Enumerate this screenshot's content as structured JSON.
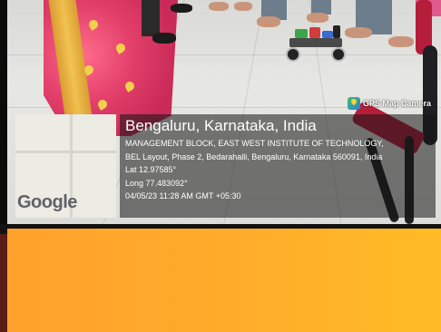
{
  "watermark": {
    "app_name": "GPS Map Camera",
    "map_provider": "Google",
    "location_title": "Bengaluru, Karnataka, India",
    "address_line1": "MANAGEMENT BLOCK, EAST WEST INSTITUTE OF TECHNOLOGY,",
    "address_line2": "BEL Layout, Phase 2, Bedarahalli, Bengaluru, Karnataka 560091, India",
    "latitude": "Lat 12.97585°",
    "longitude": "Long 77.483092°",
    "timestamp": "04/05/23 11:28 AM GMT +05:30"
  },
  "colors": {
    "orange_panel": "#ffae2a",
    "saree_pink": "#e23f6a",
    "saree_gold": "#f2cf4c"
  },
  "icons": {
    "gps_logo": "gps-map-camera-logo-icon"
  }
}
